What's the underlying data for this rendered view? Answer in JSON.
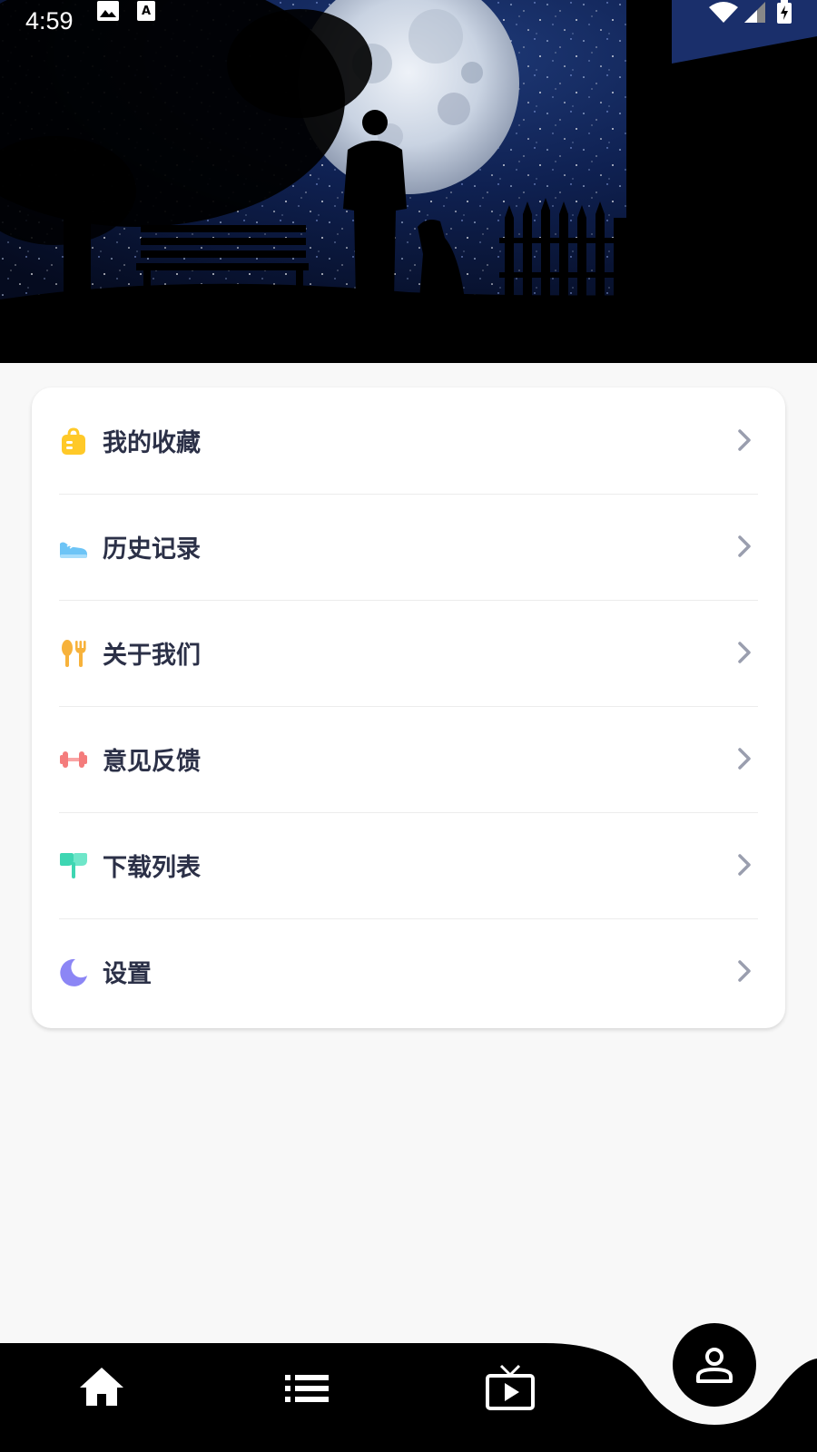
{
  "status_bar": {
    "time": "4:59"
  },
  "menu": {
    "items": [
      {
        "label": "我的收藏",
        "icon": "bag-icon",
        "color": "#FFC928"
      },
      {
        "label": "历史记录",
        "icon": "shoe-icon",
        "color": "#6DC4F6"
      },
      {
        "label": "关于我们",
        "icon": "fork-knife-icon",
        "color": "#F7B23B"
      },
      {
        "label": "意见反馈",
        "icon": "dumbbell-icon",
        "color": "#F47C7C"
      },
      {
        "label": "下载列表",
        "icon": "plant-icon",
        "color": "#3ED6B2"
      },
      {
        "label": "设置",
        "icon": "moon-icon",
        "color": "#8C86F5"
      }
    ]
  },
  "bottom_nav": {
    "items": [
      {
        "icon": "home-icon"
      },
      {
        "icon": "list-icon"
      },
      {
        "icon": "tv-play-icon"
      },
      {
        "icon": "person-icon",
        "active": true
      }
    ]
  },
  "colors": {
    "label_text": "#2B3047",
    "chevron": "#9A9EAE",
    "nav_bar": "#000000",
    "page_bg": "#F8F8F8"
  }
}
